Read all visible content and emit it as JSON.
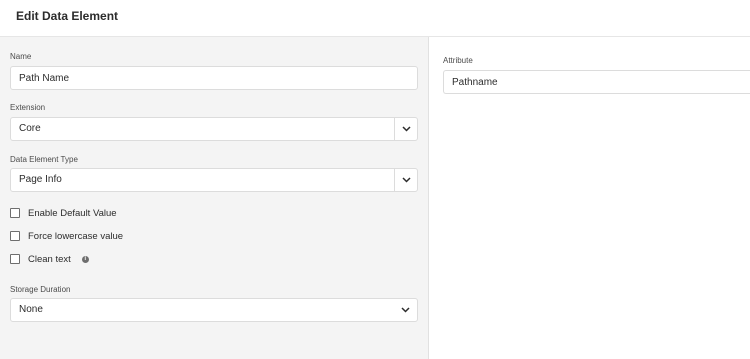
{
  "header": {
    "title": "Edit Data Element"
  },
  "form": {
    "name_label": "Name",
    "name_value": "Path Name",
    "extension_label": "Extension",
    "extension_value": "Core",
    "type_label": "Data Element Type",
    "type_value": "Page Info",
    "checkboxes": [
      {
        "label": "Enable Default Value",
        "checked": false
      },
      {
        "label": "Force lowercase value",
        "checked": false
      },
      {
        "label": "Clean text",
        "checked": false
      }
    ],
    "storage_label": "Storage Duration",
    "storage_value": "None"
  },
  "settings": {
    "attribute_label": "Attribute",
    "attribute_value": "Pathname"
  },
  "icons": {
    "info": "info-icon",
    "chevron": "chevron-down-icon"
  },
  "colors": {
    "panel_bg": "#f4f4f4",
    "field_border": "#dcdcdc",
    "text": "#2c2c2c"
  }
}
